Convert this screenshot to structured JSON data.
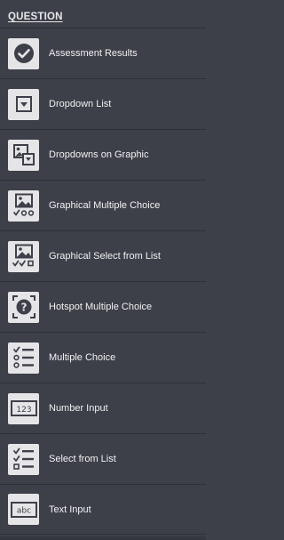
{
  "header": {
    "title": "QUESTION"
  },
  "items": [
    {
      "label": "Assessment Results",
      "icon": "check-circle-icon"
    },
    {
      "label": "Dropdown List",
      "icon": "dropdown-icon"
    },
    {
      "label": "Dropdowns on Graphic",
      "icon": "image-dropdown-icon"
    },
    {
      "label": "Graphical Multiple Choice",
      "icon": "image-radio-icon"
    },
    {
      "label": "Graphical Select from List",
      "icon": "image-checklist-icon"
    },
    {
      "label": "Hotspot Multiple Choice",
      "icon": "hotspot-icon"
    },
    {
      "label": "Multiple Choice",
      "icon": "radio-list-icon"
    },
    {
      "label": "Number Input",
      "icon": "number-input-icon",
      "icon_text": "123"
    },
    {
      "label": "Select from List",
      "icon": "checklist-icon"
    },
    {
      "label": "Text Input",
      "icon": "text-input-icon",
      "icon_text": "abc"
    }
  ]
}
